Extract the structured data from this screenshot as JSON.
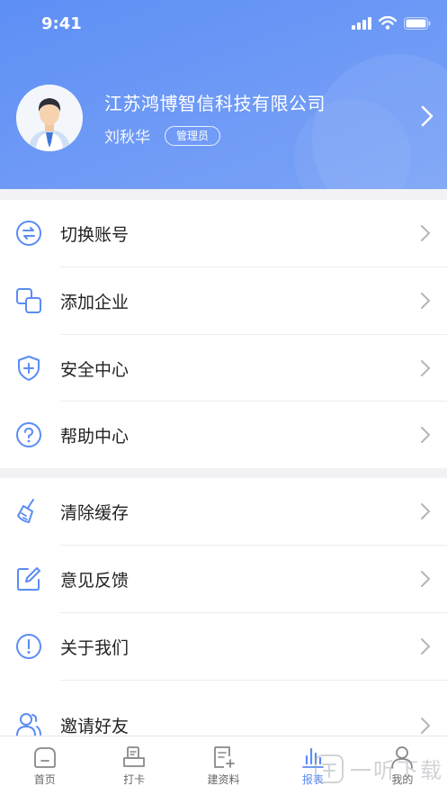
{
  "status": {
    "time": "9:41"
  },
  "profile": {
    "company": "江苏鸿博智信科技有限公司",
    "name": "刘秋华",
    "role": "管理员"
  },
  "menu": {
    "items": [
      {
        "label": "切换账号",
        "icon": "switch-icon"
      },
      {
        "label": "添加企业",
        "icon": "add-company-icon"
      },
      {
        "label": "安全中心",
        "icon": "shield-plus-icon"
      },
      {
        "label": "帮助中心",
        "icon": "help-icon"
      },
      {
        "label": "清除缓存",
        "icon": "broom-icon"
      },
      {
        "label": "意见反馈",
        "icon": "feedback-edit-icon"
      },
      {
        "label": "关于我们",
        "icon": "info-icon"
      },
      {
        "label": "邀请好友",
        "icon": "invite-friends-icon"
      }
    ]
  },
  "tabs": [
    {
      "label": "首页",
      "icon": "home-icon"
    },
    {
      "label": "打卡",
      "icon": "clock-in-icon"
    },
    {
      "label": "建资料",
      "icon": "create-document-icon"
    },
    {
      "label": "报表",
      "icon": "report-chart-icon",
      "active": true
    },
    {
      "label": "我的",
      "icon": "profile-icon"
    }
  ],
  "watermark": {
    "text": "一听下载"
  },
  "colors": {
    "accent": "#5b8cf5",
    "header": "#6a97f6",
    "icon": "#5b8cf5"
  }
}
